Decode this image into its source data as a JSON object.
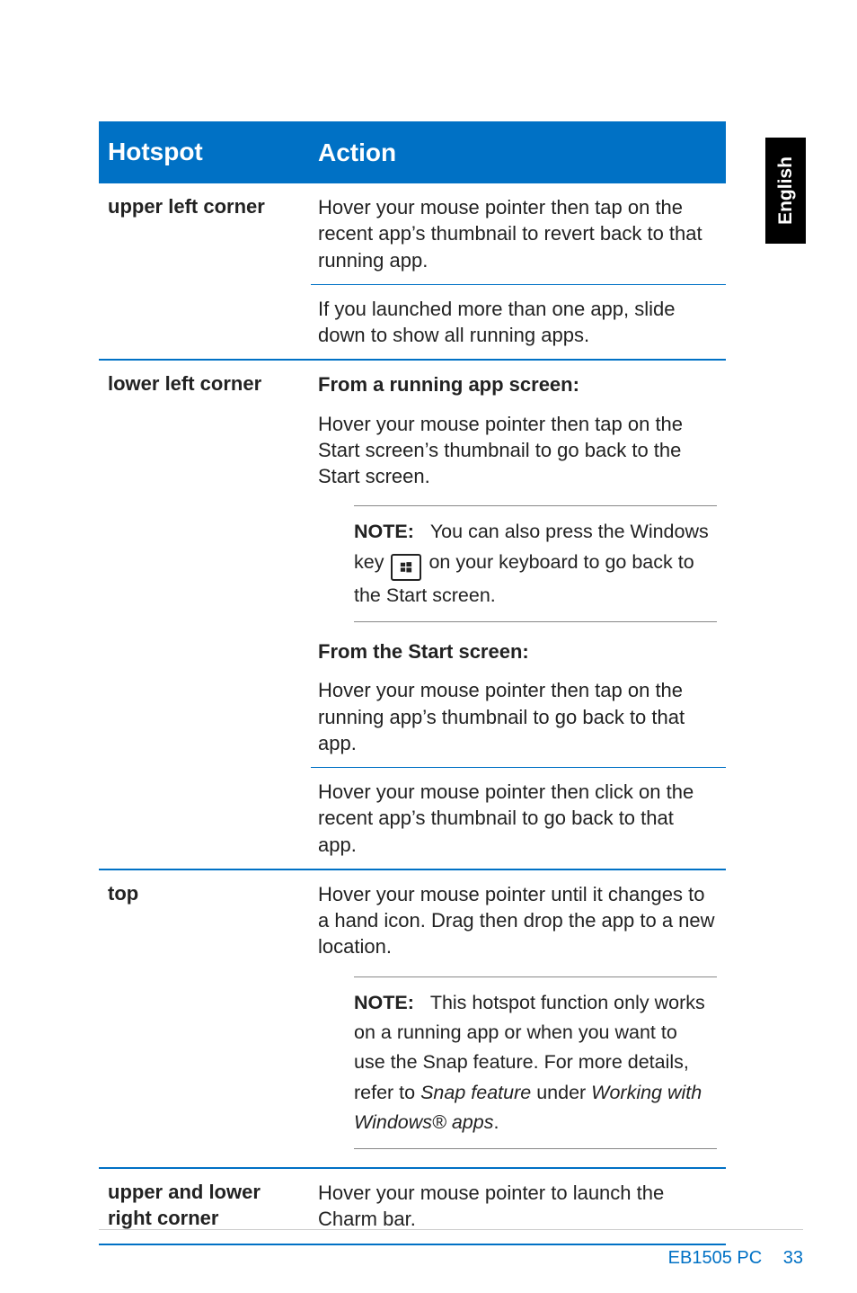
{
  "lang_tab": "English",
  "headers": {
    "hotspot": "Hotspot",
    "action": "Action"
  },
  "rows": {
    "ulc": {
      "label": "upper left corner",
      "action1": "Hover your mouse pointer then tap on the recent app’s thumbnail to revert back to that running app.",
      "action2": "If you launched more than one app, slide down to show all running apps."
    },
    "llc": {
      "label": "lower left corner",
      "subhead1": "From a running app screen:",
      "para1": "Hover your mouse pointer then tap on the Start screen’s thumbnail to go back to the Start screen.",
      "note": {
        "label": "NOTE:",
        "text_part1": "You can also press the Windows",
        "text_key_prefix": "key",
        "text_part2": "on your keyboard to go back to the Start screen."
      },
      "subhead2": "From the Start screen:",
      "para2": "Hover your mouse pointer then tap on the running app’s thumbnail to go back to that app.",
      "para3": "Hover your mouse pointer then click on the recent app’s thumbnail to go back to that app."
    },
    "top": {
      "label": "top",
      "para1": "Hover your mouse pointer until it changes to a hand icon. Drag then drop the app to a new location.",
      "note": {
        "label": "NOTE:",
        "text_part1": "This hotspot function only works on a running app or when you want to use the Snap feature. For more details, refer to ",
        "italic1": "Snap feature",
        "mid": " under ",
        "italic2": "Working with Windows® apps",
        "end": "."
      }
    },
    "ulr": {
      "label1": "upper and lower",
      "label2": "right corner",
      "action": "Hover your mouse pointer to launch the Charm bar."
    }
  },
  "footer": {
    "model": "EB1505 PC",
    "page": "33"
  }
}
